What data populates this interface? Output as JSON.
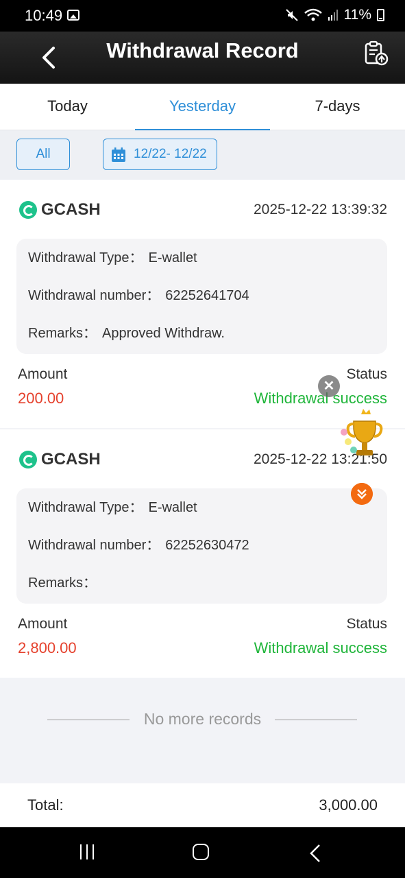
{
  "statusbar": {
    "time": "10:49",
    "battery": "11%"
  },
  "header": {
    "title": "Withdrawal Record"
  },
  "tabs": [
    {
      "label": "Today"
    },
    {
      "label": "Yesterday"
    },
    {
      "label": "7-days"
    }
  ],
  "filters": {
    "all_label": "All",
    "date_range": "12/22- 12/22"
  },
  "records": [
    {
      "brand": "GCASH",
      "datetime": "2025-12-22 13:39:32",
      "type_label": "Withdrawal Type：",
      "type_value": "E-wallet",
      "number_label": "Withdrawal number：",
      "number_value": "62252641704",
      "remarks_label": "Remarks：",
      "remarks_value": "Approved Withdraw.",
      "amount_label": "Amount",
      "amount_value": "200.00",
      "status_label": "Status",
      "status_value": "Withdrawal success"
    },
    {
      "brand": "GCASH",
      "datetime": "2025-12-22 13:21:50",
      "type_label": "Withdrawal Type：",
      "type_value": "E-wallet",
      "number_label": "Withdrawal number：",
      "number_value": "62252630472",
      "remarks_label": "Remarks：",
      "remarks_value": "",
      "amount_label": "Amount",
      "amount_value": "2,800.00",
      "status_label": "Status",
      "status_value": "Withdrawal success"
    }
  ],
  "footer_note": "No more records",
  "total": {
    "label": "Total:",
    "value": "3,000.00"
  },
  "colors": {
    "accent": "#2f8fd8",
    "amount": "#e5412d",
    "success": "#1fb53a",
    "header": "#1c1c1c"
  }
}
